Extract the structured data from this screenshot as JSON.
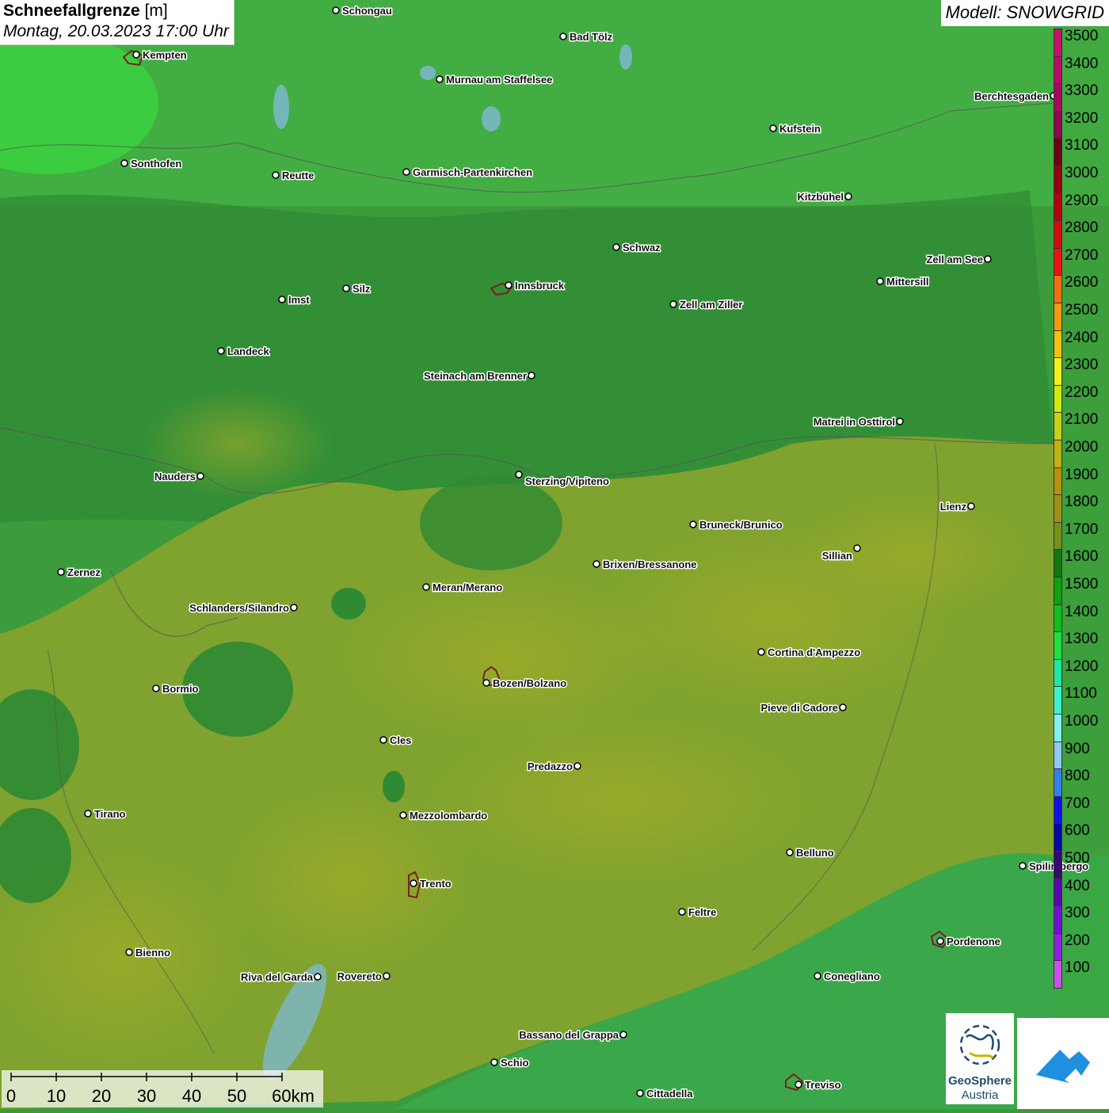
{
  "title": {
    "main": "Schneefallgrenze",
    "unit": "[m]",
    "date": "Montag, 20.03.2023 17:00 Uhr"
  },
  "model": "Modell: SNOWGRID",
  "legend": {
    "labels": [
      "3500",
      "3400",
      "3300",
      "3200",
      "3100",
      "3000",
      "2900",
      "2800",
      "2700",
      "2600",
      "2500",
      "2400",
      "2300",
      "2200",
      "2100",
      "2000",
      "1900",
      "1800",
      "1700",
      "1600",
      "1500",
      "1400",
      "1300",
      "1200",
      "1100",
      "1000",
      "900",
      "800",
      "700",
      "600",
      "500",
      "400",
      "300",
      "200",
      "100"
    ],
    "colors": [
      "#c8106e",
      "#b80c66",
      "#a6085e",
      "#8a0650",
      "#6a0015",
      "#900010",
      "#b40010",
      "#d40c0c",
      "#f01010",
      "#f07010",
      "#f59a10",
      "#f5c010",
      "#f0f020",
      "#d0e810",
      "#c8d018",
      "#c0b010",
      "#b89010",
      "#a09018",
      "#789018",
      "#107810",
      "#10a010",
      "#10c020",
      "#20e040",
      "#20e8a0",
      "#40f0d0",
      "#80f0f0",
      "#90c8f0",
      "#3080e8",
      "#1010e8",
      "#0808a0",
      "#380870",
      "#5808a8",
      "#7010d0",
      "#9020e0",
      "#c850e8"
    ]
  },
  "cities": [
    {
      "name": "Schongau"
    },
    {
      "name": "Bad Tölz"
    },
    {
      "name": "Kempten"
    },
    {
      "name": "Murnau am Staffelsee"
    },
    {
      "name": "Berchtesgaden"
    },
    {
      "name": "Kufstein"
    },
    {
      "name": "Sonthofen"
    },
    {
      "name": "Reutte"
    },
    {
      "name": "Garmisch-Partenkirchen"
    },
    {
      "name": "Kitzbühel"
    },
    {
      "name": "Schwaz"
    },
    {
      "name": "Zell am See"
    },
    {
      "name": "Innsbruck"
    },
    {
      "name": "Mittersill"
    },
    {
      "name": "Imst"
    },
    {
      "name": "Silz"
    },
    {
      "name": "Zell am Ziller"
    },
    {
      "name": "Landeck"
    },
    {
      "name": "Steinach am Brenner"
    },
    {
      "name": "Matrei in Osttirol"
    },
    {
      "name": "Nauders"
    },
    {
      "name": "Sterzing/Vipiteno"
    },
    {
      "name": "Lienz"
    },
    {
      "name": "Bruneck/Brunico"
    },
    {
      "name": "Sillian"
    },
    {
      "name": "Zernez"
    },
    {
      "name": "Brixen/Bressanone"
    },
    {
      "name": "Meran/Merano"
    },
    {
      "name": "Schlanders/Silandro"
    },
    {
      "name": "Cortina d'Ampezzo"
    },
    {
      "name": "Bozen/Bolzano"
    },
    {
      "name": "Bormio"
    },
    {
      "name": "Pieve di Cadore"
    },
    {
      "name": "Cles"
    },
    {
      "name": "Predazzo"
    },
    {
      "name": "Tirano"
    },
    {
      "name": "Mezzolombardo"
    },
    {
      "name": "Belluno"
    },
    {
      "name": "Spilimbergo"
    },
    {
      "name": "Trento"
    },
    {
      "name": "Feltre"
    },
    {
      "name": "Pordenone"
    },
    {
      "name": "Bienno"
    },
    {
      "name": "Riva del Garda"
    },
    {
      "name": "Rovereto"
    },
    {
      "name": "Conegliano"
    },
    {
      "name": "Bassano del Grappa"
    },
    {
      "name": "Schio"
    },
    {
      "name": "Treviso"
    },
    {
      "name": "Cittadella"
    }
  ],
  "scale": {
    "labels": [
      "0",
      "10",
      "20",
      "30",
      "40",
      "50",
      "60km"
    ]
  },
  "logo": {
    "line1": "GeoSphere",
    "line2": "Austria"
  }
}
